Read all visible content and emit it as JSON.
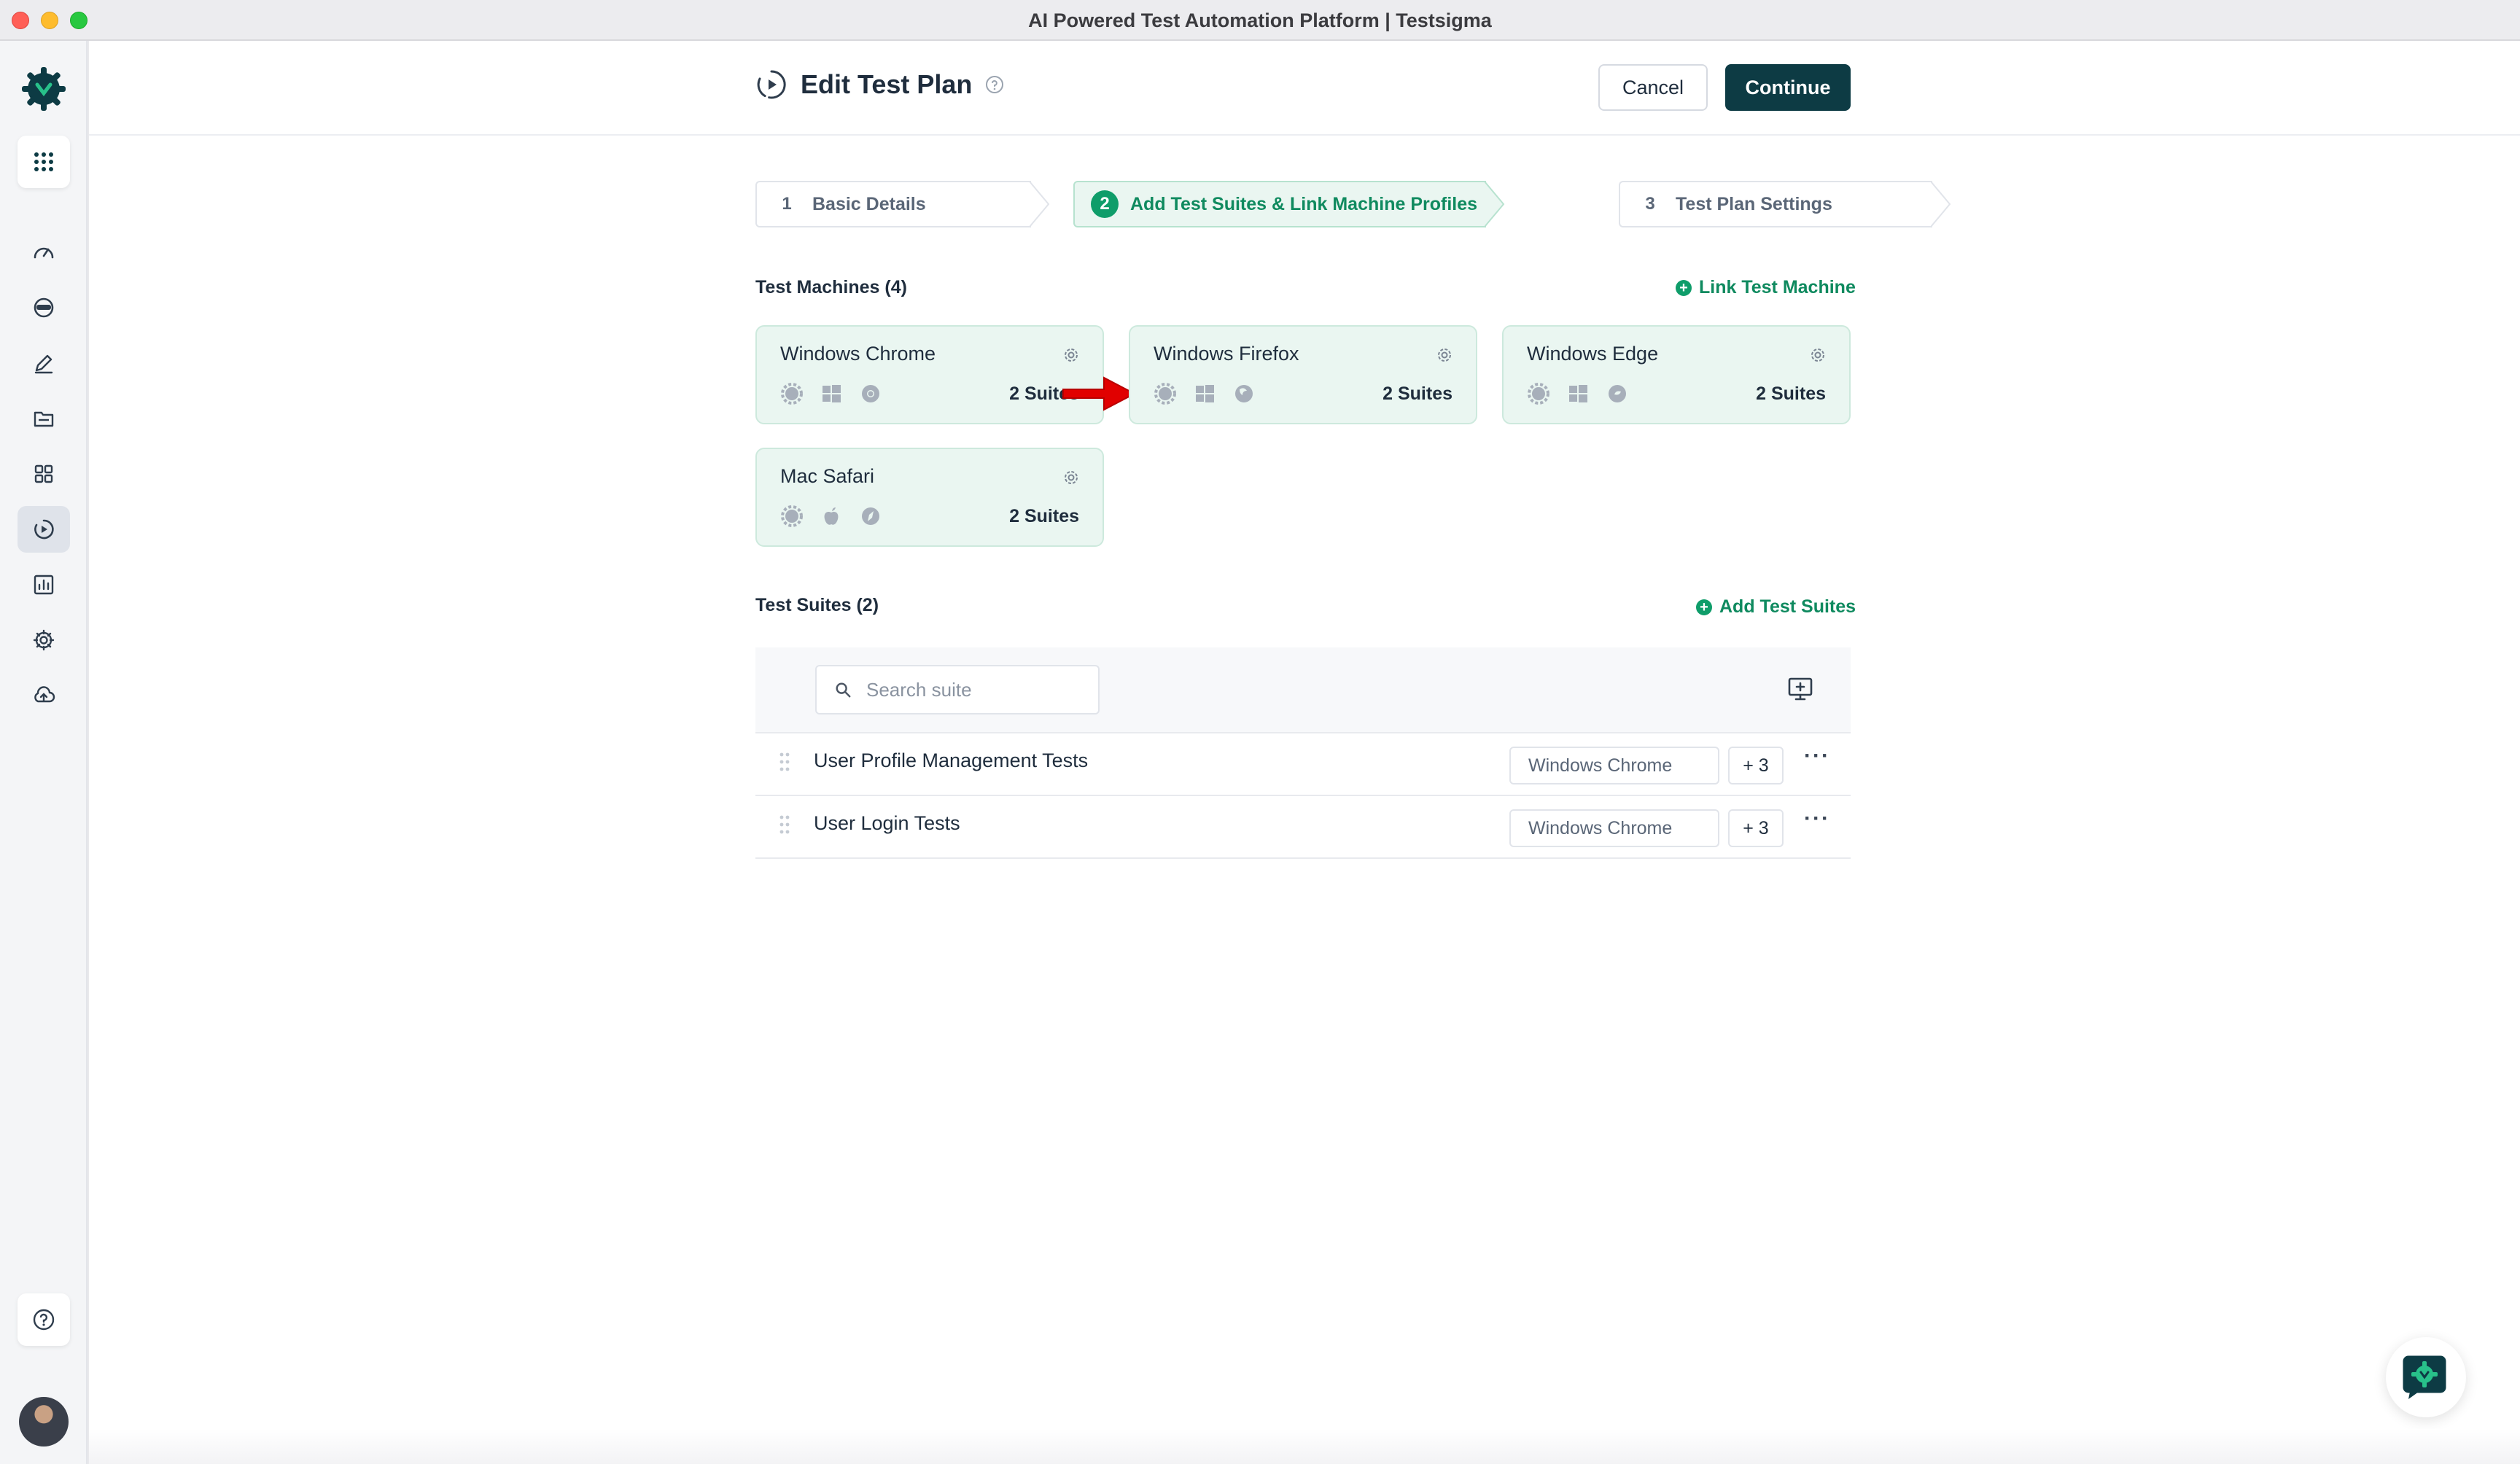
{
  "window": {
    "title": "AI Powered Test Automation Platform | Testsigma"
  },
  "header": {
    "title": "Edit Test Plan",
    "cancel_label": "Cancel",
    "continue_label": "Continue"
  },
  "steps": [
    {
      "number": "1",
      "label": "Basic Details",
      "active": false
    },
    {
      "number": "2",
      "label": "Add Test Suites & Link Machine Profiles",
      "active": true
    },
    {
      "number": "3",
      "label": "Test Plan Settings",
      "active": false
    }
  ],
  "machines": {
    "title": "Test Machines (4)",
    "link_label": "Link Test Machine",
    "items": [
      {
        "name": "Windows Chrome",
        "suites": "2 Suites",
        "os_icon": "windows-icon",
        "browser_icon": "chrome-icon"
      },
      {
        "name": "Windows Firefox",
        "suites": "2 Suites",
        "os_icon": "windows-icon",
        "browser_icon": "firefox-icon"
      },
      {
        "name": "Windows Edge",
        "suites": "2 Suites",
        "os_icon": "windows-icon",
        "browser_icon": "edge-icon"
      },
      {
        "name": "Mac Safari",
        "suites": "2 Suites",
        "os_icon": "apple-icon",
        "browser_icon": "safari-icon"
      }
    ]
  },
  "suites": {
    "title": "Test Suites (2)",
    "add_label": "Add Test Suites",
    "search_placeholder": "Search suite",
    "rows": [
      {
        "name": "User Profile Management Tests",
        "machine": "Windows Chrome",
        "more": "+ 3",
        "menu": "···"
      },
      {
        "name": "User Login Tests",
        "machine": "Windows Chrome",
        "more": "+ 3",
        "menu": "···"
      }
    ]
  },
  "colors": {
    "brand_dark": "#0d3b44",
    "accent_green": "#0f9d6a",
    "card_bg": "#eaf6f1",
    "highlight_red": "#e10000"
  }
}
